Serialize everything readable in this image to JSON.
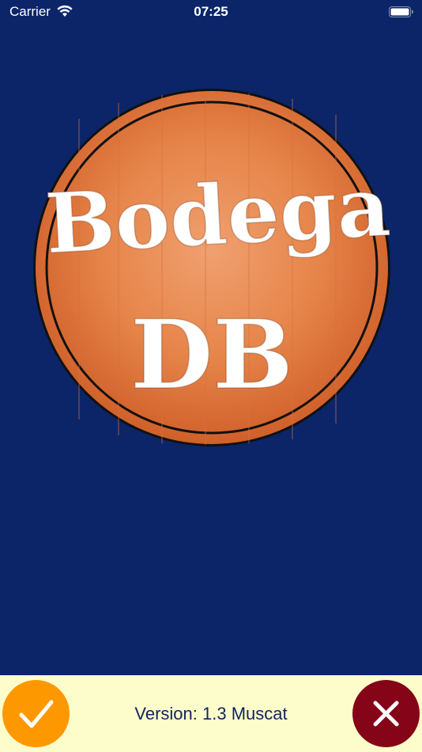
{
  "status_bar": {
    "carrier": "Carrier",
    "time": "07:25",
    "wifi_icon": "wifi-icon",
    "battery_icon": "battery-icon"
  },
  "logo": {
    "line1": "Bodega",
    "line2": "DB"
  },
  "footer": {
    "version_label": "Version: 1.3 Muscat",
    "accept_icon": "checkmark-icon",
    "close_icon": "close-icon"
  },
  "colors": {
    "background": "#0b2568",
    "footer_background": "#fdfdcb",
    "accept_button": "#fe9800",
    "close_button": "#850418",
    "logo_wood": "#e47a3a"
  }
}
